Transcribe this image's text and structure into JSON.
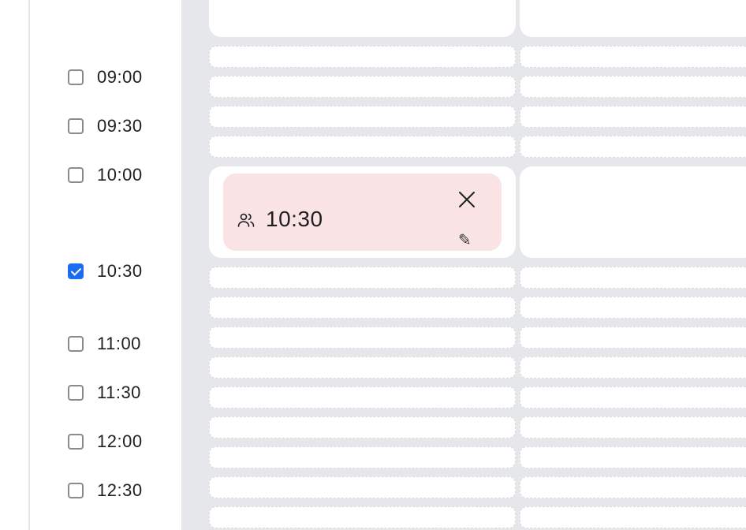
{
  "sidebar": {
    "times": [
      {
        "label": "09:00",
        "checked": false
      },
      {
        "label": "09:30",
        "checked": false
      },
      {
        "label": "10:00",
        "checked": false
      },
      {
        "label": "10:30",
        "checked": true
      },
      {
        "label": "11:00",
        "checked": false
      },
      {
        "label": "11:30",
        "checked": false
      },
      {
        "label": "12:00",
        "checked": false
      },
      {
        "label": "12:30",
        "checked": false
      }
    ]
  },
  "booking": {
    "time": "10:30",
    "icon": "people-icon",
    "close_icon": "close-icon",
    "edit_icon": "pencil-icon",
    "edit_glyph": "✎"
  },
  "colors": {
    "accent": "#1a6cf0",
    "booking_bg": "#f9e3e5",
    "grid_bg": "#e6e7eb"
  }
}
